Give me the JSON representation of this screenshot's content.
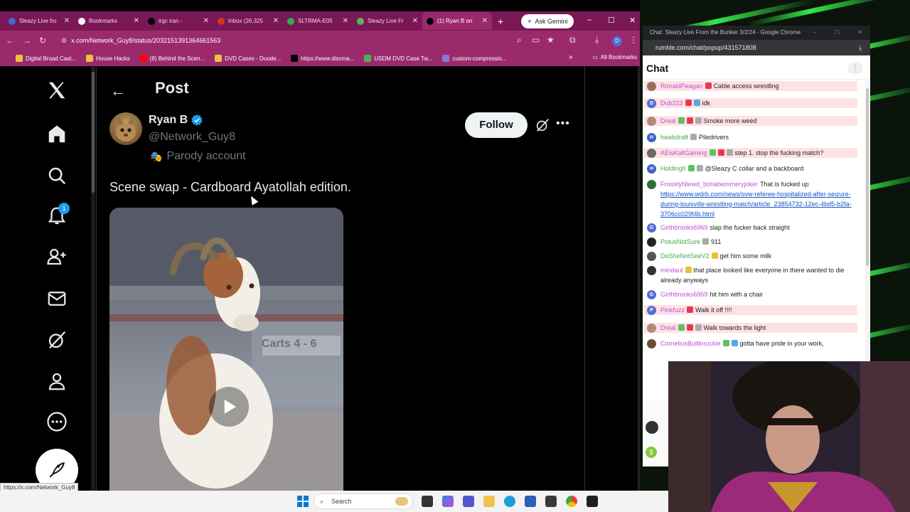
{
  "browser": {
    "tabs": [
      {
        "label": "Sleazy Live fro",
        "color": "#3b6ad7",
        "active": false
      },
      {
        "label": "Bookmarks",
        "color": "#ffffff",
        "active": false
      },
      {
        "label": "irgc iran -",
        "color": "#000000",
        "active": false
      },
      {
        "label": "Inbox (26,325",
        "color": "#d93025",
        "active": false
      },
      {
        "label": "SLTRMA-E05",
        "color": "#34a853",
        "active": false
      },
      {
        "label": "Sleazy Live Fr",
        "color": "#5ab552",
        "active": false
      },
      {
        "label": "(1) Ryan B on",
        "color": "#000000",
        "active": true
      }
    ],
    "ask_gemini": "Ask Gemini",
    "url": "x.com/Network_Guy8/status/2032151391364661563",
    "bookmarks": [
      {
        "label": "Digital Broad Cast..."
      },
      {
        "label": "House Hacks"
      },
      {
        "label": "(8) Behind the Scen..."
      },
      {
        "label": "DVD Cases - Duode..."
      },
      {
        "label": "https://www.discma..."
      },
      {
        "label": "USDM DVD Case Tw..."
      },
      {
        "label": "custom-compressio..."
      }
    ],
    "all_bookmarks": "All Bookmarks",
    "status_url": "https://x.com/Network_Guy8"
  },
  "x": {
    "page_title": "Post",
    "notification_count": "1",
    "author": {
      "name": "Ryan B",
      "handle": "@Network_Guy8",
      "label": "Parody account"
    },
    "follow_label": "Follow",
    "tweet_text": "Scene swap - Cardboard Ayatollah edition.",
    "media_sign": "Carts 4 - 6"
  },
  "chat_window": {
    "title": "Chat: Sleazy Live From the Bunker 3/2/24 - Google Chrome",
    "url": "rumble.com/chat/popup/431571808",
    "header": "Chat",
    "messages": [
      {
        "user": "RonaldPeagan",
        "text": "Cable access wrestling",
        "user_color": "#c14fd6",
        "avatar_color": "#9b6e5a",
        "highlight": true,
        "badges": [
          "#e23a55"
        ]
      },
      {
        "user": "Dub223",
        "text": "idk",
        "user_color": "#c14fd6",
        "avatar_color": "#5b6ad0",
        "avatar_letter": "D",
        "highlight": true,
        "badges": [
          "#e23a55",
          "#5aa7e0"
        ]
      },
      {
        "user": "Dreal",
        "text": "Smoke more weed",
        "user_color": "#c14fd6",
        "avatar_color": "#b08a7a",
        "highlight": true,
        "badges": [
          "#5cc35c",
          "#e23a55",
          "#aaaaaa"
        ]
      },
      {
        "user": "hawkdraft",
        "text": "Piledrivers",
        "user_color": "#44aa44",
        "avatar_color": "#3f5fc8",
        "avatar_letter": "H",
        "highlight": false,
        "badges": [
          "#aaaaaa"
        ]
      },
      {
        "user": "AEisKaltGaming",
        "text": "step 1. stop the fucking match?",
        "user_color": "#c14fd6",
        "avatar_color": "#6a6a6a",
        "highlight": true,
        "badges": [
          "#5cc35c",
          "#e23a55",
          "#aaaaaa"
        ]
      },
      {
        "user": "HoldingII",
        "text": "@Sleazy C collar and a backboard",
        "user_color": "#44aa44",
        "avatar_color": "#3f5fc8",
        "avatar_letter": "H",
        "highlight": false,
        "badges": [
          "#5cc35c",
          "#aaaaaa"
        ]
      },
      {
        "user": "FroostyNlewd_bohabemmeryjoker",
        "text": "That is fucked up",
        "link": "https://www.wdrb.com/news/ovw-referee-hospitalized-after-seizure-during-louisville-wrestling-match/article_23854732-12ec-4bd5-b2fa-3706cc029f4b.html",
        "user_color": "#c14fd6",
        "avatar_color": "#2f6e3a",
        "highlight": false,
        "badges": []
      },
      {
        "user": "Girthbrooks6969",
        "text": "slap the fucker back straight",
        "user_color": "#c14fd6",
        "avatar_color": "#5b6ad0",
        "avatar_letter": "G",
        "highlight": false,
        "badges": []
      },
      {
        "user": "PotusNotSure",
        "text": "911",
        "user_color": "#44aa44",
        "avatar_color": "#222222",
        "highlight": false,
        "badges": [
          "#aaaaaa"
        ]
      },
      {
        "user": "DoSheNotSeeV2",
        "text": "get him some milk",
        "user_color": "#44aa44",
        "avatar_color": "#555555",
        "highlight": false,
        "badges": [
          "#e6c23a"
        ]
      },
      {
        "user": "mindaul",
        "text": "that place looked like everyone in there wanted to die already anyways",
        "user_color": "#c14fd6",
        "avatar_color": "#333333",
        "highlight": false,
        "badges": [
          "#e6c23a"
        ]
      },
      {
        "user": "Girthbrooks6969",
        "text": "hit him with a chair",
        "user_color": "#c14fd6",
        "avatar_color": "#5b6ad0",
        "avatar_letter": "G",
        "highlight": false,
        "badges": []
      },
      {
        "user": "Pinkfuzz",
        "text": "Walk it off !!!!",
        "user_color": "#c14fd6",
        "avatar_color": "#5b6ad0",
        "avatar_letter": "P",
        "highlight": true,
        "badges": [
          "#e23a55"
        ]
      },
      {
        "user": "Dreal",
        "text": "Walk towards the light",
        "user_color": "#c14fd6",
        "avatar_color": "#b08a7a",
        "highlight": true,
        "badges": [
          "#5cc35c",
          "#e23a55",
          "#aaaaaa"
        ]
      },
      {
        "user": "CorneliusButtknuckle",
        "text": "gotta have pride in your work,",
        "user_color": "#c14fd6",
        "avatar_color": "#6a4a3a",
        "highlight": false,
        "badges": [
          "#5cc35c",
          "#5aa7e0"
        ]
      }
    ]
  },
  "taskbar": {
    "search_placeholder": "Search"
  },
  "colors": {
    "browser_frame": "#9b2a6d",
    "x_blue": "#1d9bf0"
  }
}
